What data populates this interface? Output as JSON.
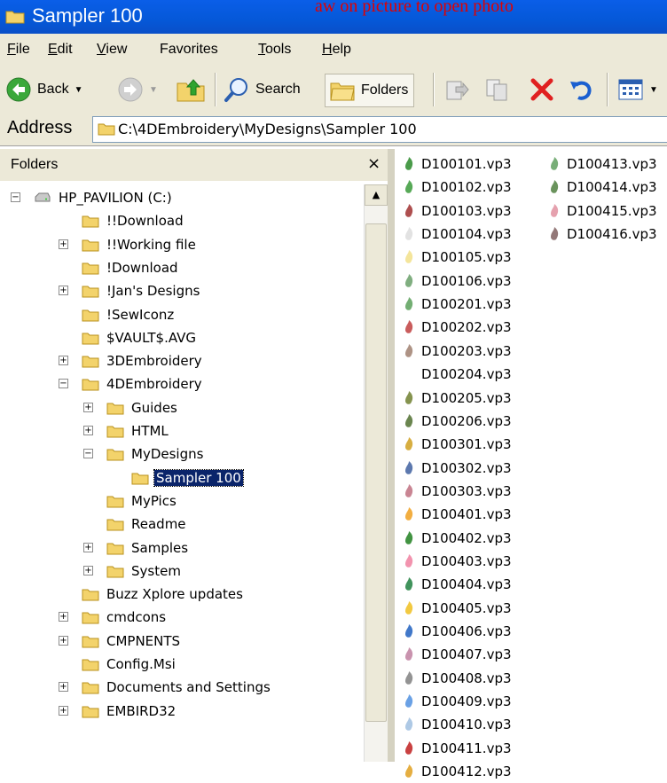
{
  "window": {
    "title": "Sampler 100",
    "overlay_text": "aw on picture to open photo"
  },
  "menu": {
    "items": [
      {
        "label": "File",
        "u": "F",
        "rest": "ile"
      },
      {
        "label": "Edit",
        "u": "E",
        "rest": "dit"
      },
      {
        "label": "View",
        "u": "V",
        "rest": "iew"
      },
      {
        "label": "Favorites",
        "u": "",
        "rest": "Favorites"
      },
      {
        "label": "Tools",
        "u": "T",
        "rest": "ools"
      },
      {
        "label": "Help",
        "u": "H",
        "rest": "elp"
      }
    ]
  },
  "toolbar": {
    "back_label": "Back",
    "search_label": "Search",
    "folders_label": "Folders"
  },
  "address": {
    "label": "Address",
    "path": "C:\\4DEmbroidery\\MyDesigns\\Sampler 100"
  },
  "folders": {
    "title": "Folders",
    "close": "×",
    "tree": [
      {
        "label": "HP_PAVILION (C:)"
      },
      {
        "label": "!!Download"
      },
      {
        "label": "!!Working file"
      },
      {
        "label": "!Download"
      },
      {
        "label": "!Jan's Designs"
      },
      {
        "label": "!SewIconz"
      },
      {
        "label": "$VAULT$.AVG"
      },
      {
        "label": "3DEmbroidery"
      },
      {
        "label": "4DEmbroidery"
      },
      {
        "label": "Guides"
      },
      {
        "label": "HTML"
      },
      {
        "label": "MyDesigns"
      },
      {
        "label": "Sampler 100"
      },
      {
        "label": "MyPics"
      },
      {
        "label": "Readme"
      },
      {
        "label": "Samples"
      },
      {
        "label": "System"
      },
      {
        "label": "Buzz Xplore updates"
      },
      {
        "label": "cmdcons"
      },
      {
        "label": "CMPNENTS"
      },
      {
        "label": "Config.Msi"
      },
      {
        "label": "Documents and Settings"
      },
      {
        "label": "EMBIRD32"
      }
    ]
  },
  "files": {
    "col1": [
      "D100101.vp3",
      "D100102.vp3",
      "D100103.vp3",
      "D100104.vp3",
      "D100105.vp3",
      "D100106.vp3",
      "D100201.vp3",
      "D100202.vp3",
      "D100203.vp3",
      "D100204.vp3",
      "D100205.vp3",
      "D100206.vp3",
      "D100301.vp3",
      "D100302.vp3",
      "D100303.vp3",
      "D100401.vp3",
      "D100402.vp3",
      "D100403.vp3",
      "D100404.vp3",
      "D100405.vp3",
      "D100406.vp3",
      "D100407.vp3",
      "D100408.vp3",
      "D100409.vp3",
      "D100410.vp3",
      "D100411.vp3",
      "D100412.vp3"
    ],
    "col2": [
      "D100413.vp3",
      "D100414.vp3",
      "D100415.vp3",
      "D100416.vp3"
    ]
  },
  "colors": {
    "titlebar": "#0558d8",
    "selection": "#0a246a",
    "folder": "#f3d36b",
    "delete": "#e02020"
  }
}
